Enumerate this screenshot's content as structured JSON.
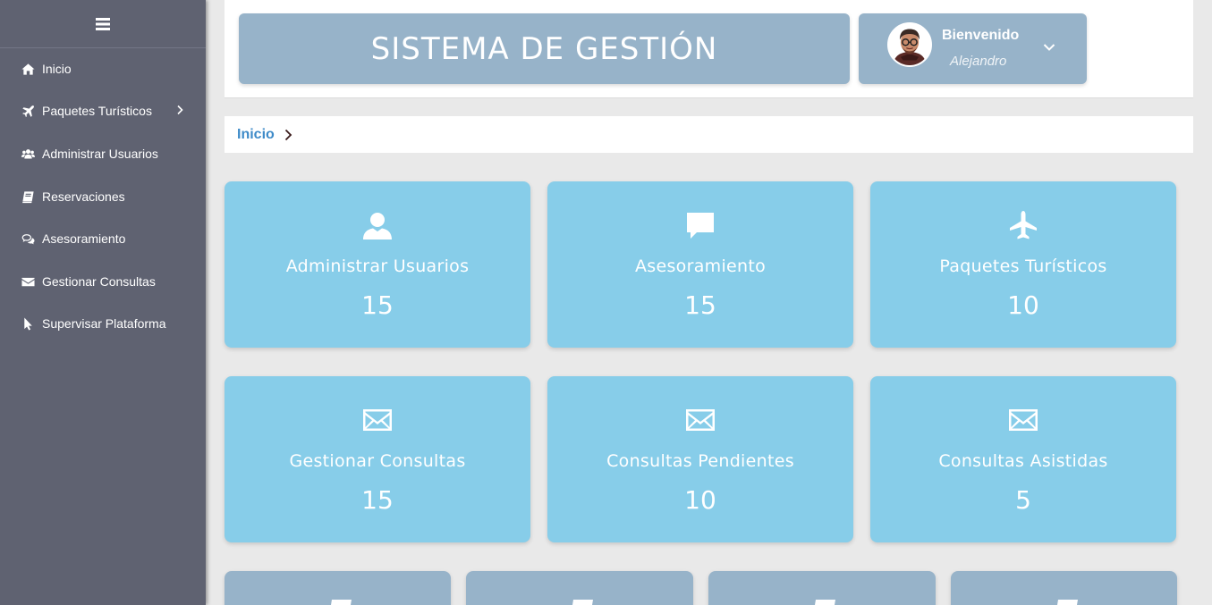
{
  "header": {
    "title": "SISTEMA DE GESTIÓN",
    "welcome": "Bienvenido",
    "username": "Alejandro"
  },
  "sidebar": {
    "items": [
      {
        "label": "Inicio",
        "icon": "home-icon"
      },
      {
        "label": "Paquetes Turísticos",
        "icon": "plane-icon"
      },
      {
        "label": "Administrar Usuarios",
        "icon": "users-icon"
      },
      {
        "label": "Reservaciones",
        "icon": "book-icon"
      },
      {
        "label": "Asesoramiento",
        "icon": "comments-icon"
      },
      {
        "label": "Gestionar Consultas",
        "icon": "envelope-icon"
      },
      {
        "label": "Supervisar Plataforma",
        "icon": "pointer-icon"
      }
    ]
  },
  "breadcrumb": {
    "home": "Inicio"
  },
  "cards": [
    {
      "label": "Administrar Usuarios",
      "value": "15",
      "icon": "user-icon"
    },
    {
      "label": "Asesoramiento",
      "value": "15",
      "icon": "comment-icon"
    },
    {
      "label": "Paquetes Turísticos",
      "value": "10",
      "icon": "plane-icon"
    },
    {
      "label": "Gestionar Consultas",
      "value": "15",
      "icon": "envelope-icon"
    },
    {
      "label": "Consultas Pendientes",
      "value": "10",
      "icon": "envelope-icon"
    },
    {
      "label": "Consultas Asistidas",
      "value": "5",
      "icon": "envelope-icon"
    }
  ],
  "colors": {
    "sidebar": "#5f6271",
    "header_box": "#97b3c9",
    "card": "#87cde9",
    "link": "#3d8ac8"
  }
}
